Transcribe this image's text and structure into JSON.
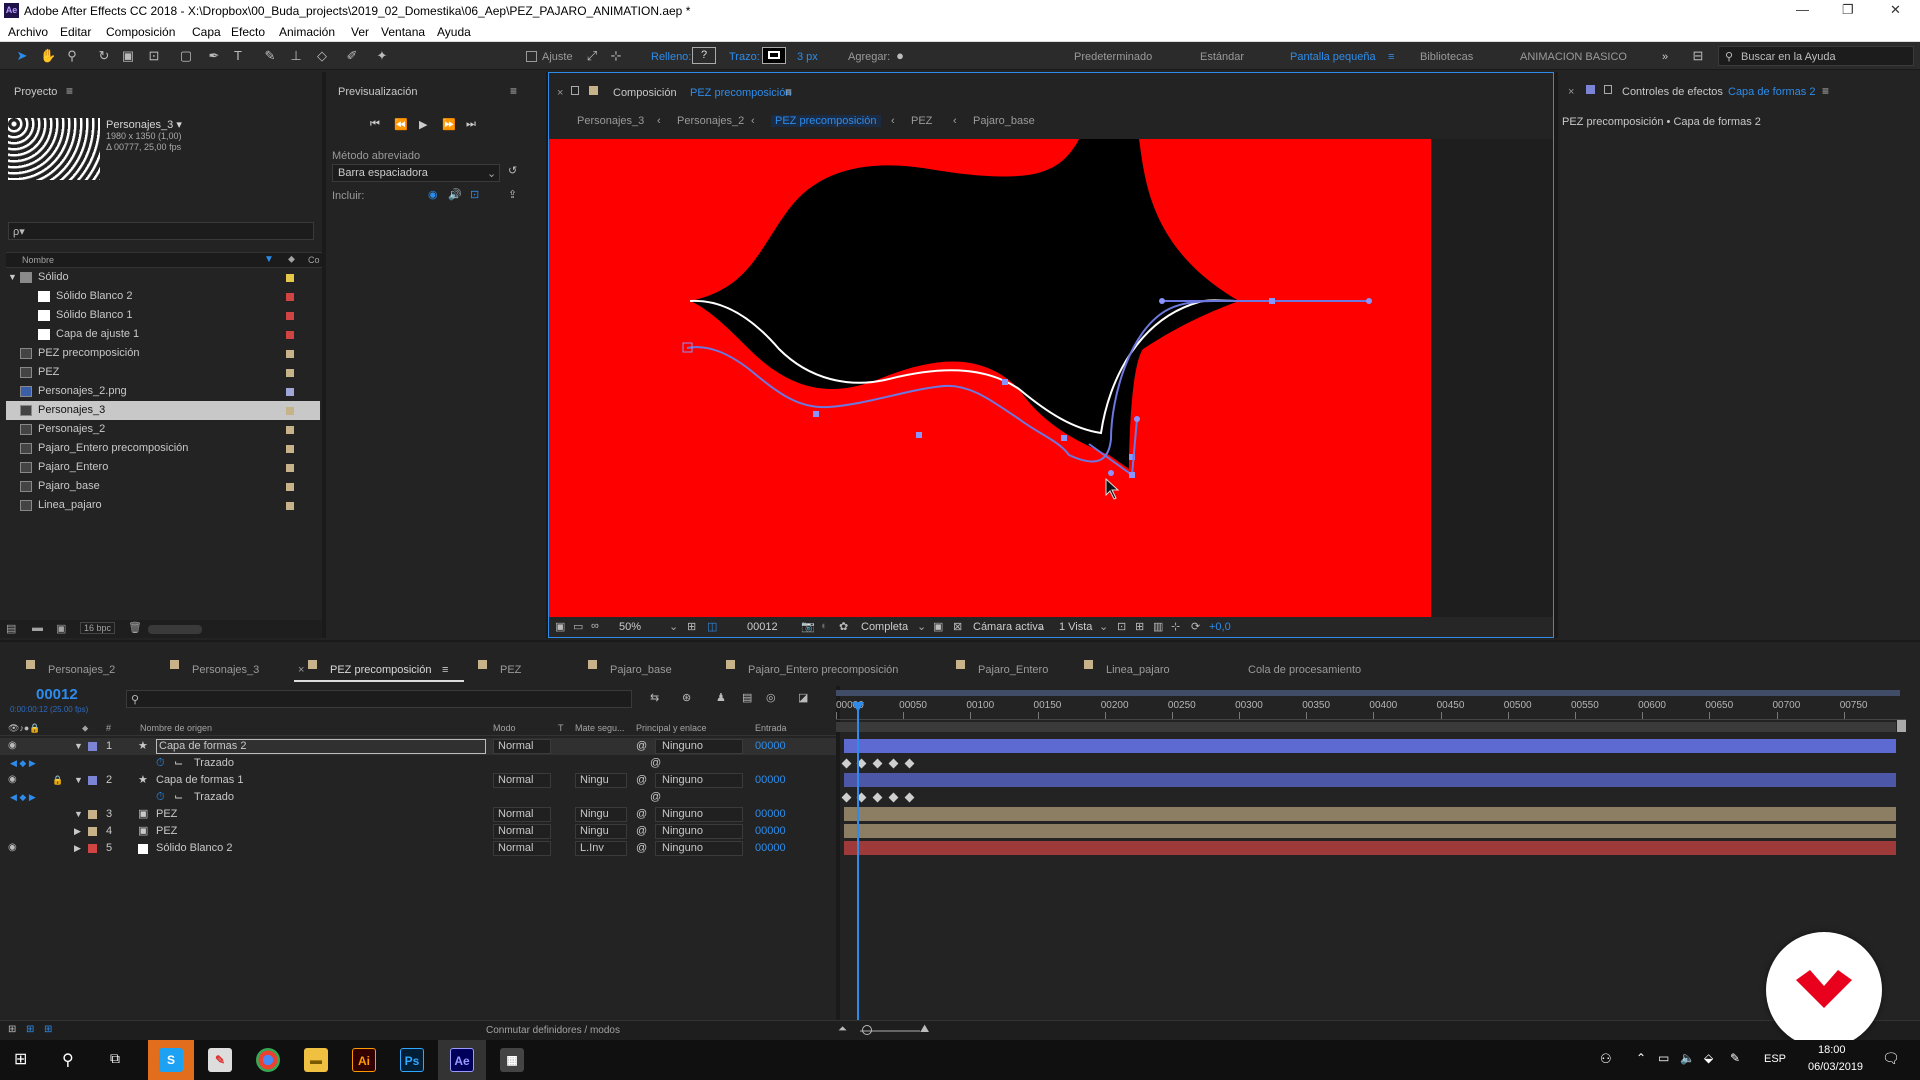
{
  "window": {
    "app_icon": "Ae",
    "title": "Adobe After Effects CC 2018 - X:\\Dropbox\\00_Buda_projects\\2019_02_Domestika\\06_Aep\\PEZ_PAJARO_ANIMATION.aep *"
  },
  "menu": [
    "Archivo",
    "Editar",
    "Composición",
    "Capa",
    "Efecto",
    "Animación",
    "Ver",
    "Ventana",
    "Ayuda"
  ],
  "toolbar": {
    "ajuste": "Ajuste",
    "relleno": "Relleno:",
    "relleno_value": "?",
    "trazo": "Trazo:",
    "trazo_px": "3 px",
    "agregar": "Agregar:",
    "workspaces": [
      "Predeterminado",
      "Estándar",
      "Pantalla pequeña",
      "Bibliotecas",
      "ANIMACION BASICO"
    ],
    "active_workspace": "Pantalla pequeña",
    "search_placeholder": "Buscar en la Ayuda",
    "accent": "#2d8ceb"
  },
  "project": {
    "title": "Proyecto",
    "item_name": "Personajes_3 ▾",
    "item_dims": "1980 x 1350 (1,00)",
    "item_time": "Δ 00777, 25,00 fps",
    "search_placeholder": "ρ▾",
    "col_nombre": "Nombre",
    "col_co": "Co",
    "bpc": "16 bpc",
    "items": [
      {
        "label": "Sólido",
        "type": "folder",
        "color": "#e5c74a",
        "indent": 0
      },
      {
        "label": "Sólido Blanco 2",
        "type": "solid",
        "color": "#d04444",
        "indent": 1
      },
      {
        "label": "Sólido Blanco 1",
        "type": "solid",
        "color": "#d04444",
        "indent": 1
      },
      {
        "label": "Capa de ajuste 1",
        "type": "solid",
        "color": "#d04444",
        "indent": 1
      },
      {
        "label": "PEZ precomposición",
        "type": "comp",
        "color": "#c7b28a",
        "indent": 0
      },
      {
        "label": "PEZ",
        "type": "comp",
        "color": "#c7b28a",
        "indent": 0
      },
      {
        "label": "Personajes_2.png",
        "type": "image",
        "color": "#a0a7d8",
        "indent": 0
      },
      {
        "label": "Personajes_3",
        "type": "comp",
        "color": "#c7b28a",
        "indent": 0,
        "selected": true
      },
      {
        "label": "Personajes_2",
        "type": "comp",
        "color": "#c7b28a",
        "indent": 0
      },
      {
        "label": "Pajaro_Entero precomposición",
        "type": "comp",
        "color": "#c7b28a",
        "indent": 0
      },
      {
        "label": "Pajaro_Entero",
        "type": "comp",
        "color": "#c7b28a",
        "indent": 0
      },
      {
        "label": "Pajaro_base",
        "type": "comp",
        "color": "#c7b28a",
        "indent": 0
      },
      {
        "label": "Linea_pajaro",
        "type": "comp",
        "color": "#c7b28a",
        "indent": 0
      }
    ]
  },
  "preview": {
    "title": "Previsualización",
    "shortcut_label": "Método abreviado",
    "shortcut_value": "Barra espaciadora",
    "include_label": "Incluir:"
  },
  "composition": {
    "tab_prefix": "Composición",
    "tab_name": "PEZ precomposición",
    "breadcrumbs": [
      "Personajes_3",
      "Personajes_2",
      "PEZ precomposición",
      "PEZ",
      "Pajaro_base"
    ],
    "active_breadcrumb": "PEZ precomposición",
    "zoom": "50%",
    "frame": "00012",
    "resolution": "Completa",
    "camera": "Cámara activa",
    "views": "1 Vista",
    "exposure": "+0,0",
    "bg_color": "#ff0000"
  },
  "effects": {
    "tab_prefix": "Controles de efectos",
    "tab_name": "Capa de formas 2",
    "subtitle": "PEZ precomposición • Capa de formas 2"
  },
  "timeline": {
    "tabs": [
      "Personajes_2",
      "Personajes_3",
      "PEZ precomposición",
      "PEZ",
      "Pajaro_base",
      "Pajaro_Entero precomposición",
      "Pajaro_Entero",
      "Linea_pajaro",
      "Cola de procesamiento"
    ],
    "active_tab": "PEZ precomposición",
    "timecode": "00012",
    "timecode_sub": "0:00:00:12 (25.00 fps)",
    "columns": {
      "nombre": "Nombre de origen",
      "modo": "Modo",
      "t": "T",
      "mate": "Mate segu...",
      "parent": "Principal y enlace",
      "entrada": "Entrada"
    },
    "ruler": [
      "00000",
      "00050",
      "00100",
      "00150",
      "00200",
      "00250",
      "00300",
      "00350",
      "00400",
      "00450",
      "00500",
      "00550",
      "00600",
      "00650",
      "00700",
      "00750"
    ],
    "layers": [
      {
        "num": "1",
        "name": "Capa de formas 2",
        "mode": "Normal",
        "mate": "",
        "parent": "Ninguno",
        "entrada": "00000",
        "color": "#7c84d6",
        "type": "shape",
        "selected": true,
        "prop": "Trazado"
      },
      {
        "num": "2",
        "name": "Capa de formas 1",
        "mode": "Normal",
        "mate": "Ningu",
        "parent": "Ninguno",
        "entrada": "00000",
        "color": "#7c84d6",
        "type": "shape",
        "locked": true,
        "prop": "Trazado"
      },
      {
        "num": "3",
        "name": "PEZ",
        "mode": "Normal",
        "mate": "Ningu",
        "parent": "Ninguno",
        "entrada": "00000",
        "color": "#c7b28a",
        "type": "comp"
      },
      {
        "num": "4",
        "name": "PEZ",
        "mode": "Normal",
        "mate": "Ningu",
        "parent": "Ninguno",
        "entrada": "00000",
        "color": "#c7b28a",
        "type": "comp"
      },
      {
        "num": "5",
        "name": "Sólido Blanco 2",
        "mode": "Normal",
        "mate": "L.Inv",
        "parent": "Ninguno",
        "entrada": "00000",
        "color": "#d04444",
        "type": "solid"
      }
    ],
    "footer": "Conmutar definidores / modos"
  },
  "taskbar": {
    "lang": "ESP",
    "time": "18:00",
    "date": "06/03/2019",
    "apps": [
      "Ai",
      "Ps",
      "Ae"
    ]
  }
}
